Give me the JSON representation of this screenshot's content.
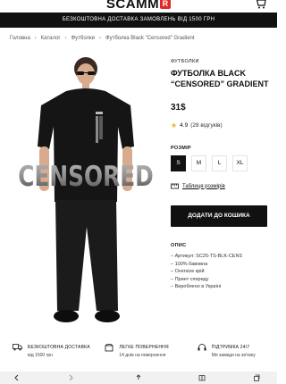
{
  "header": {
    "logo": "SCAMM",
    "logo_mark": "R",
    "cart_icon": "cart-icon"
  },
  "promo": {
    "text": "БЕЗКОШТОВНА ДОСТАВКА ЗАМОВЛЕНЬ ВІД 1500 ГРН"
  },
  "breadcrumbs": [
    "Головна",
    "Каталог",
    "Футболки",
    "Футболка Black \"Censored\" Gradient"
  ],
  "product": {
    "category": "ФУТБОЛКИ",
    "title": "ФУТБОЛКА BLACK “CENSORED” GRADIENT",
    "price": "31$",
    "rating": "4.9",
    "reviews": "(28 відгуків)",
    "size_label": "РОЗМІР",
    "sizes": [
      "S",
      "M",
      "L",
      "XL"
    ],
    "selected_size": "S",
    "size_chart_link": "Таблиця розмірів",
    "buy_button": "ДОДАТИ ДО КОШИКА",
    "description_title": "ОПИС",
    "description": [
      "– Артикул: SC25-TS-BLK-CENS",
      "– 100% бавовна",
      "– Oversize крій",
      "– Принт спереду",
      "– Вироблено в Україні"
    ],
    "print_text": "CENSORED"
  },
  "features": [
    {
      "icon": "truck-icon",
      "title": "БЕЗКОШТОВНА ДОСТАВКА",
      "subtitle": "від 1500 грн"
    },
    {
      "icon": "return-icon",
      "title": "ЛЕГКЕ ПОВЕРНЕННЯ",
      "subtitle": "14 днів на повернення"
    },
    {
      "icon": "support-icon",
      "title": "ПІДТРИМКА 24/7",
      "subtitle": "Ми завжди на зв'язку"
    }
  ],
  "colors": {
    "brand_red": "#e32726",
    "dark": "#111111",
    "star": "#e9b22e"
  }
}
